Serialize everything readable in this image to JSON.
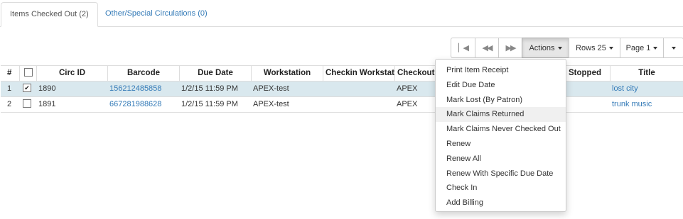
{
  "tabs": [
    {
      "label": "Items Checked Out (2)",
      "active": true
    },
    {
      "label": "Other/Special Circulations (0)",
      "active": false
    }
  ],
  "toolbar": {
    "first_icon": "first-page-icon",
    "prev_icon": "prev-page-icon",
    "next_icon": "next-page-icon",
    "actions_label": "Actions",
    "rows_label": "Rows 25",
    "page_label": "Page 1"
  },
  "columns": [
    "#",
    "",
    "Circ ID",
    "Barcode",
    "Due Date",
    "Workstation",
    "Checkin Workstation",
    "Checkout",
    "Stopped",
    "Title"
  ],
  "rows": [
    {
      "num": "1",
      "checked": true,
      "circ_id": "1890",
      "barcode": "156212485858",
      "due_date": "1/2/15 11:59 PM",
      "workstation": "APEX-test",
      "checkout": "APEX",
      "title": "lost city"
    },
    {
      "num": "2",
      "checked": false,
      "circ_id": "1891",
      "barcode": "667281988628",
      "due_date": "1/2/15 11:59 PM",
      "workstation": "APEX-test",
      "checkout": "APEX",
      "title": "trunk music"
    }
  ],
  "actions_menu": [
    "Print Item Receipt",
    "Edit Due Date",
    "Mark Lost (By Patron)",
    "Mark Claims Returned",
    "Mark Claims Never Checked Out",
    "Renew",
    "Renew All",
    "Renew With Specific Due Date",
    "Check In",
    "Add Billing"
  ],
  "colors": {
    "link": "#337ab7",
    "selected_row": "#d9e8ee"
  }
}
